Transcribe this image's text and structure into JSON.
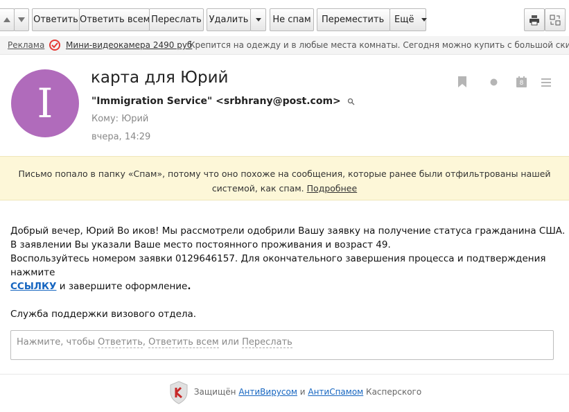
{
  "toolbar": {
    "reply": "Ответить",
    "reply_all": "Ответить всем",
    "forward": "Переслать",
    "delete": "Удалить",
    "not_spam": "Не спам",
    "move": "Переместить",
    "more": "Ещё"
  },
  "ad": {
    "label": "Реклама",
    "link": "Мини-видеокамера 2490 руб",
    "text": "Крепится на одежду и в любые места комнаты. Сегодня можно купить с большой скидк"
  },
  "email": {
    "avatar_letter": "I",
    "avatar_color": "#b06bbb",
    "subject": "карта для Юрий",
    "sender": "\"Immigration Service\" <srbhrany@post.com>",
    "to": "Кому: Юрий",
    "date": "вчера, 14:29",
    "calendar_day": "8"
  },
  "spam_notice": {
    "text": "Письмо попало в папку «Спам», потому что оно похоже на сообщения, которые ранее были отфильтрованы нашей системой, как спам.",
    "more_link": "Подробнее"
  },
  "body": {
    "line1": "Добрый вечер, Юрий Во  иков! Мы рассмотрели одобрили Вашу заявку на получение статуса гражданина США.",
    "line2": "В заявлении Вы указали Ваше место постоянного проживания  и возраст 49.",
    "line3": "Воспользуйтесь номером заявки 0129646157. Для окончательного завершения процесса и подтверждения нажмите",
    "link": "ССЫЛКУ",
    "line4_rest": "  и завершите оформление",
    "line4_dot": ".",
    "signature": "Служба поддержки визового отдела."
  },
  "reply_box": {
    "prefix": "Нажмите, чтобы ",
    "reply": "Ответить",
    "sep1": ", ",
    "reply_all": "Ответить всем",
    "sep2": " или ",
    "forward": "Переслать"
  },
  "footer": {
    "prefix": "Защищён ",
    "antivirus": "АнтиВирусом",
    "and": " и ",
    "antispam": "АнтиСпамом",
    "suffix": " Касперского"
  }
}
